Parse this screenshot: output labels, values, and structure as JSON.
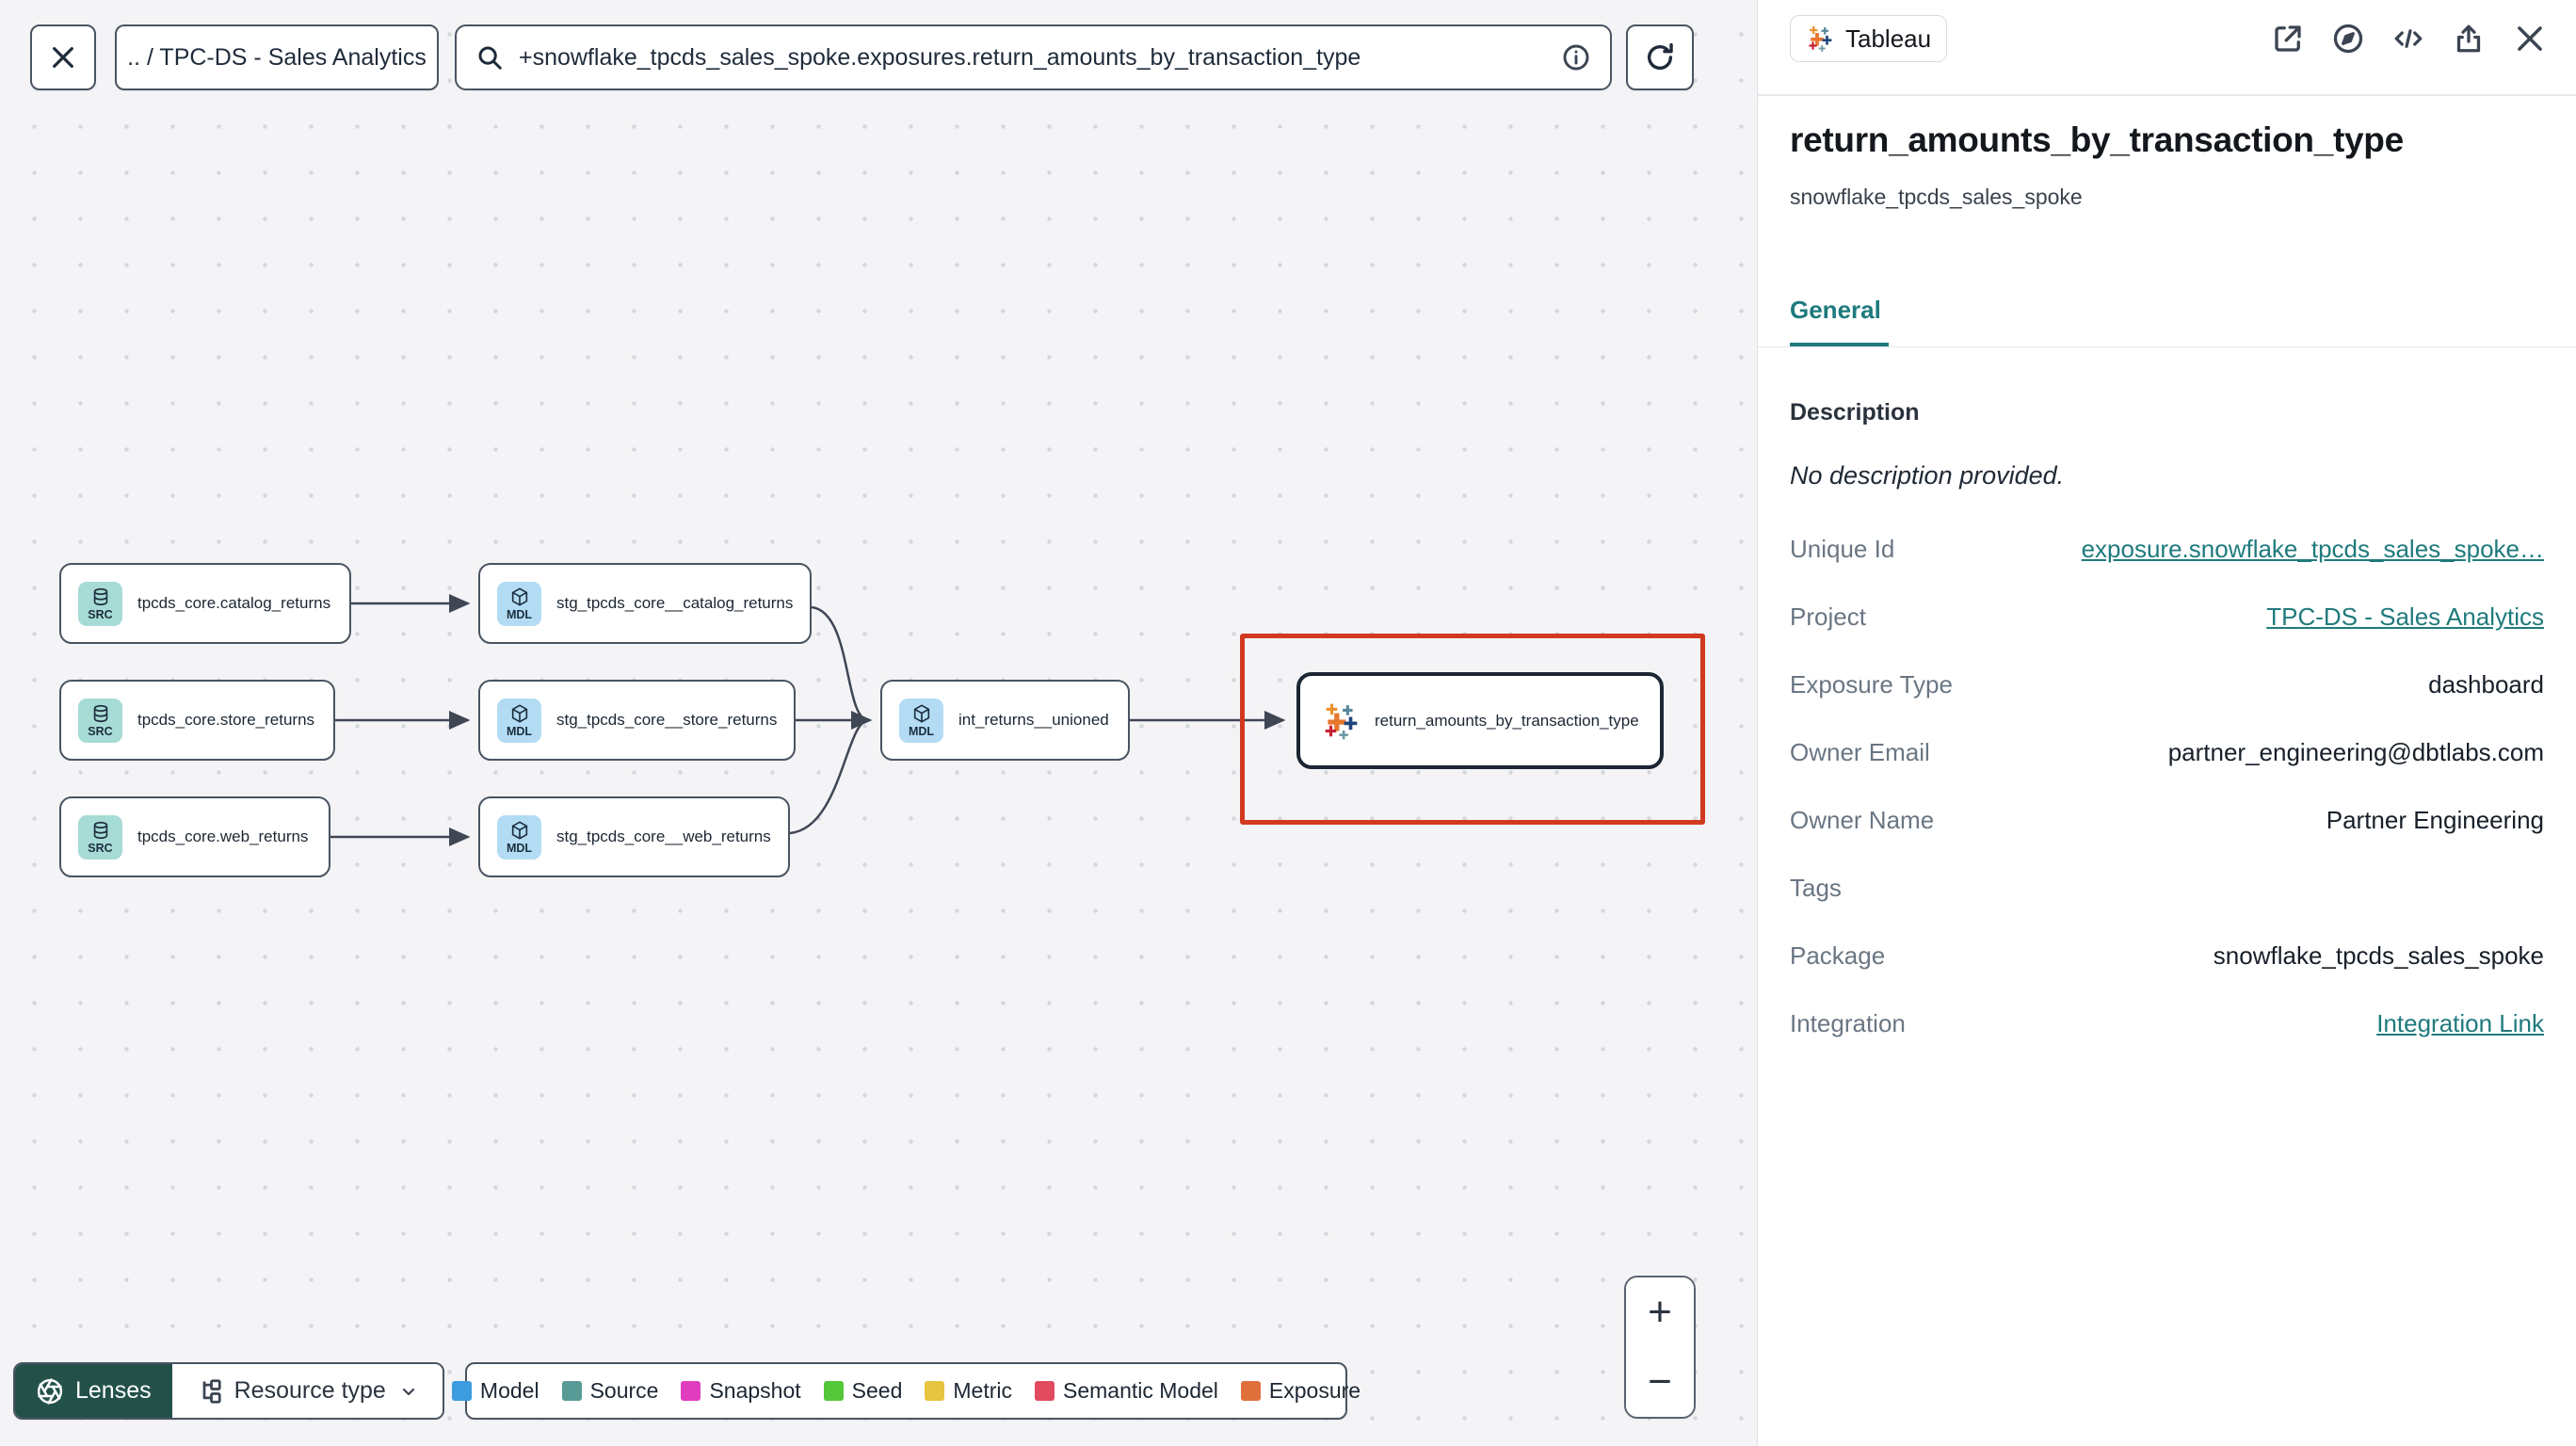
{
  "topbar": {
    "breadcrumb": ".. / TPC-DS - Sales Analytics",
    "search": {
      "value": "+snowflake_tpcds_sales_spoke.exposures.return_amounts_by_transaction_type"
    }
  },
  "graph": {
    "nodes": [
      {
        "badge": "SRC",
        "label": "tpcds_core.catalog_returns"
      },
      {
        "badge": "SRC",
        "label": "tpcds_core.store_returns"
      },
      {
        "badge": "SRC",
        "label": "tpcds_core.web_returns"
      },
      {
        "badge": "MDL",
        "label": "stg_tpcds_core__catalog_returns"
      },
      {
        "badge": "MDL",
        "label": "stg_tpcds_core__store_returns"
      },
      {
        "badge": "MDL",
        "label": "stg_tpcds_core__web_returns"
      },
      {
        "badge": "MDL",
        "label": "int_returns__unioned"
      },
      {
        "badge": "tableau",
        "label": "return_amounts_by_transaction_type"
      }
    ]
  },
  "toolbar": {
    "lenses_label": "Lenses",
    "resource_type_label": "Resource type"
  },
  "legend": {
    "items": [
      {
        "label": "Model",
        "color": "#3d9ce0"
      },
      {
        "label": "Source",
        "color": "#579a96"
      },
      {
        "label": "Snapshot",
        "color": "#e03ebf"
      },
      {
        "label": "Seed",
        "color": "#54c63a"
      },
      {
        "label": "Metric",
        "color": "#e7c440"
      },
      {
        "label": "Semantic Model",
        "color": "#e24a5f"
      },
      {
        "label": "Exposure",
        "color": "#e0703b"
      }
    ]
  },
  "zoom_controls": {
    "zoom_in": "+",
    "zoom_out": "−"
  },
  "panel": {
    "badge_label": "Tableau",
    "title": "return_amounts_by_transaction_type",
    "subtitle": "snowflake_tpcds_sales_spoke",
    "tab_general": "General",
    "description_label": "Description",
    "description_empty": "No description provided.",
    "fields": [
      {
        "label": "Unique Id",
        "value": "exposure.snowflake_tpcds_sales_spoke…",
        "link": true
      },
      {
        "label": "Project",
        "value": "TPC-DS - Sales Analytics",
        "link": true
      },
      {
        "label": "Exposure Type",
        "value": "dashboard",
        "link": false
      },
      {
        "label": "Owner Email",
        "value": "partner_engineering@dbtlabs.com",
        "link": false
      },
      {
        "label": "Owner Name",
        "value": "Partner Engineering",
        "link": false
      },
      {
        "label": "Tags",
        "value": "",
        "link": false
      },
      {
        "label": "Package",
        "value": "snowflake_tpcds_sales_spoke",
        "link": false
      },
      {
        "label": "Integration",
        "value": "Integration Link",
        "link": true
      }
    ]
  }
}
